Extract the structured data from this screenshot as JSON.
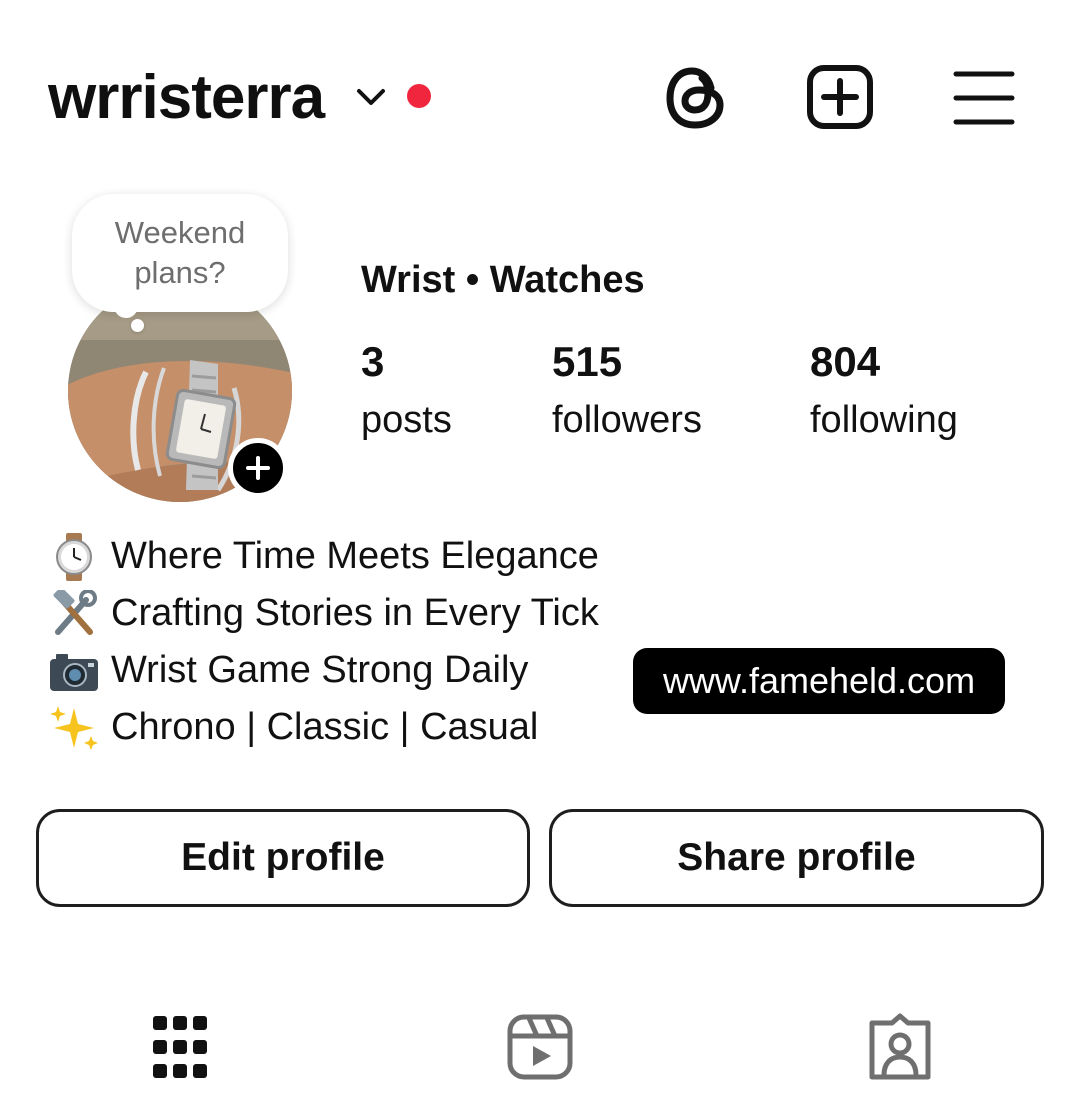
{
  "header": {
    "username": "wrristerra",
    "notification_color": "#f0263f",
    "icons": [
      "chevron-down-icon",
      "threads-icon",
      "create-post-icon",
      "menu-icon"
    ]
  },
  "profile": {
    "note": "Weekend plans?",
    "display_name": "Wrist • Watches",
    "stats": {
      "posts": {
        "value": "3",
        "label": "posts"
      },
      "followers": {
        "value": "515",
        "label": "followers"
      },
      "following": {
        "value": "804",
        "label": "following"
      }
    }
  },
  "bio": [
    {
      "emoji": "watch-icon",
      "text": "Where Time Meets Elegance"
    },
    {
      "emoji": "hammer-wrench-icon",
      "text": "Crafting Stories in Every Tick"
    },
    {
      "emoji": "camera-icon",
      "text": "Wrist Game Strong Daily"
    },
    {
      "emoji": "sparkles-icon",
      "text": "Chrono | Classic | Casual"
    }
  ],
  "link_tag": "www.fameheld.com",
  "buttons": {
    "edit": "Edit profile",
    "share": "Share profile"
  },
  "tabs": [
    {
      "icon": "grid-icon",
      "selected": true
    },
    {
      "icon": "reels-icon",
      "selected": false
    },
    {
      "icon": "tagged-icon",
      "selected": false
    }
  ]
}
